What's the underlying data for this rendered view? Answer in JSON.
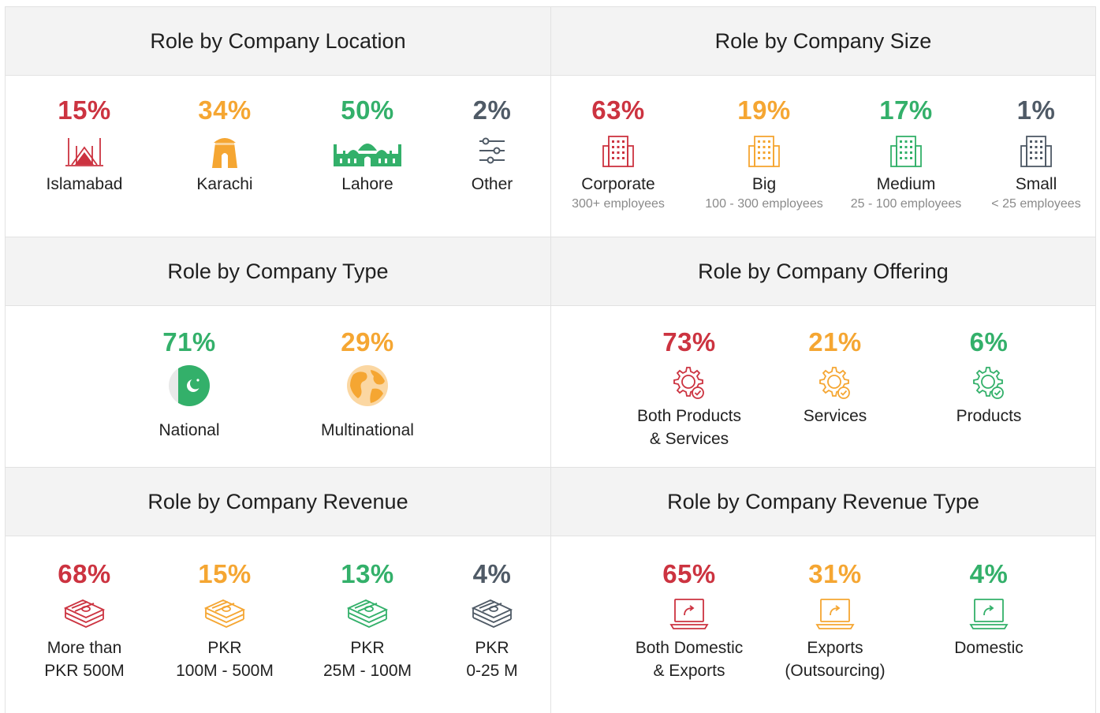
{
  "location": {
    "title": "Role by Company Location",
    "items": [
      {
        "pct": "15%",
        "label": "Islamabad",
        "icon": "faisal-mosque-icon",
        "color": "#cc3340"
      },
      {
        "pct": "34%",
        "label": "Karachi",
        "icon": "mazar-e-quaid-icon",
        "color": "#f5a632"
      },
      {
        "pct": "50%",
        "label": "Lahore",
        "icon": "badshahi-mosque-icon",
        "color": "#33b06a"
      },
      {
        "pct": "2%",
        "label": "Other",
        "icon": "sliders-icon",
        "color": "#4f5a66"
      }
    ]
  },
  "size": {
    "title": "Role by Company Size",
    "items": [
      {
        "pct": "63%",
        "label": "Corporate",
        "sub": "300+ employees",
        "icon": "building-icon",
        "color": "#cc3340"
      },
      {
        "pct": "19%",
        "label": "Big",
        "sub": "100 - 300 employees",
        "icon": "building-icon",
        "color": "#f5a632"
      },
      {
        "pct": "17%",
        "label": "Medium",
        "sub": "25 - 100 employees",
        "icon": "building-icon",
        "color": "#33b06a"
      },
      {
        "pct": "1%",
        "label": "Small",
        "sub": "< 25 employees",
        "icon": "building-icon",
        "color": "#4f5a66"
      }
    ]
  },
  "type": {
    "title": "Role by Company Type",
    "items": [
      {
        "pct": "71%",
        "label": "National",
        "icon": "pakistan-flag-icon",
        "color": "#33b06a"
      },
      {
        "pct": "29%",
        "label": "Multinational",
        "icon": "globe-icon",
        "color": "#f5a632"
      }
    ]
  },
  "offering": {
    "title": "Role by Company Offering",
    "items": [
      {
        "pct": "73%",
        "label1": "Both Products",
        "label2": "& Services",
        "icon": "gear-check-icon",
        "color": "#cc3340"
      },
      {
        "pct": "21%",
        "label1": "Services",
        "label2": "",
        "icon": "gear-check-icon",
        "color": "#f5a632"
      },
      {
        "pct": "6%",
        "label1": "Products",
        "label2": "",
        "icon": "gear-check-icon",
        "color": "#33b06a"
      }
    ]
  },
  "revenue": {
    "title": "Role by Company Revenue",
    "items": [
      {
        "pct": "68%",
        "label1": "More than",
        "label2": "PKR 500M",
        "icon": "money-stack-icon",
        "color": "#cc3340"
      },
      {
        "pct": "15%",
        "label1": "PKR",
        "label2": "100M - 500M",
        "icon": "money-stack-icon",
        "color": "#f5a632"
      },
      {
        "pct": "13%",
        "label1": "PKR",
        "label2": "25M - 100M",
        "icon": "money-stack-icon",
        "color": "#33b06a"
      },
      {
        "pct": "4%",
        "label1": "PKR",
        "label2": "0-25 M",
        "icon": "money-stack-icon",
        "color": "#4f5a66"
      }
    ]
  },
  "revenue_type": {
    "title": "Role by Company Revenue Type",
    "items": [
      {
        "pct": "65%",
        "label1": "Both Domestic",
        "label2": "& Exports",
        "icon": "laptop-share-icon",
        "color": "#cc3340"
      },
      {
        "pct": "31%",
        "label1": "Exports",
        "label2": "(Outsourcing)",
        "icon": "laptop-share-icon",
        "color": "#f5a632"
      },
      {
        "pct": "4%",
        "label1": "Domestic",
        "label2": "",
        "icon": "laptop-share-icon",
        "color": "#33b06a"
      }
    ]
  }
}
